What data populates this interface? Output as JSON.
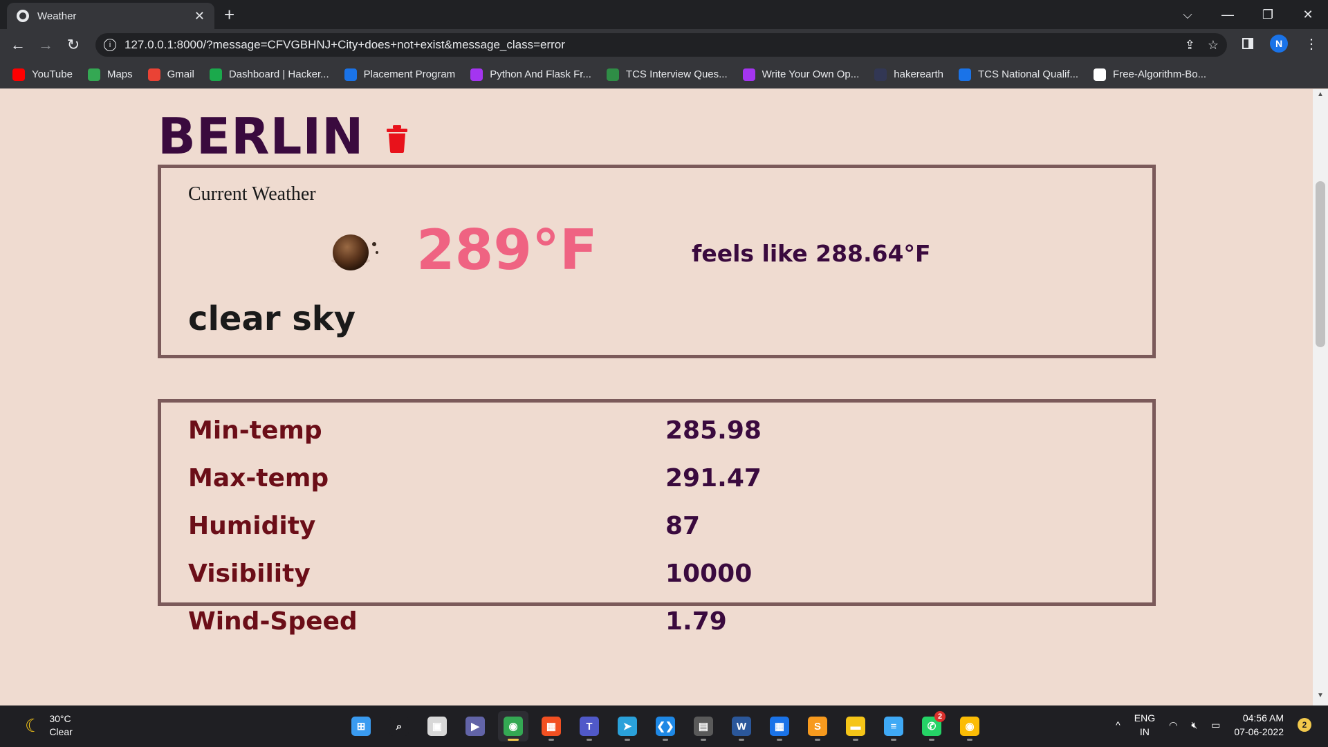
{
  "browser": {
    "tab_title": "Weather",
    "tab_close": "✕",
    "new_tab": "+",
    "url": "127.0.0.1:8000/?message=CFVGBHNJ+City+does+not+exist&message_class=error",
    "profile_initial": "N",
    "window_controls": {
      "dropdown": "⌵",
      "minimize": "—",
      "restore": "❐",
      "close": "✕"
    }
  },
  "bookmarks": [
    {
      "label": "YouTube",
      "icon": "youtube-icon",
      "color": "#ff0000"
    },
    {
      "label": "Maps",
      "icon": "maps-icon",
      "color": "#34a853"
    },
    {
      "label": "Gmail",
      "icon": "gmail-icon",
      "color": "#ea4335"
    },
    {
      "label": "Dashboard | Hacker...",
      "icon": "hackerrank-icon",
      "color": "#1ba94c"
    },
    {
      "label": "Placement Program",
      "icon": "placement-icon",
      "color": "#1a73e8"
    },
    {
      "label": "Python And Flask Fr...",
      "icon": "udemy-icon",
      "color": "#a435f0"
    },
    {
      "label": "TCS Interview Ques...",
      "icon": "gfg-icon",
      "color": "#2f8d46"
    },
    {
      "label": "Write Your Own Op...",
      "icon": "udemy-icon",
      "color": "#a435f0"
    },
    {
      "label": "hakerearth",
      "icon": "hackerearth-icon",
      "color": "#323754"
    },
    {
      "label": "TCS National Qualif...",
      "icon": "tcs-icon",
      "color": "#1a73e8"
    },
    {
      "label": "Free-Algorithm-Bo...",
      "icon": "github-icon",
      "color": "#ffffff"
    }
  ],
  "weather": {
    "city": "BERLIN",
    "current_label": "Current Weather",
    "temperature": "289°F",
    "feels_like": "feels like 288.64°F",
    "condition": "clear sky",
    "stats": [
      {
        "label": "Min-temp",
        "value": "285.98"
      },
      {
        "label": "Max-temp",
        "value": "291.47"
      },
      {
        "label": "Humidity",
        "value": "87"
      },
      {
        "label": "Visibility",
        "value": "10000"
      },
      {
        "label": "Wind-Speed",
        "value": "1.79"
      }
    ]
  },
  "colors": {
    "page_bg": "#efdbd0",
    "city_title": "#3a0a3e",
    "temperature": "#ef6382",
    "card_border": "#7b5a5a",
    "stat_label": "#6b0e18",
    "trash": "#e8121b"
  },
  "taskbar": {
    "weather_temp": "30°C",
    "weather_desc": "Clear",
    "lang_top": "ENG",
    "lang_bottom": "IN",
    "time": "04:56 AM",
    "date": "07-06-2022",
    "notification_count": "2",
    "whatsapp_badge": "2",
    "apps": [
      {
        "name": "start-button",
        "glyph": "⊞",
        "color": "#3a9bf0"
      },
      {
        "name": "search-button",
        "glyph": "⌕",
        "color": "#1f1f23"
      },
      {
        "name": "task-view-button",
        "glyph": "▣",
        "color": "#d8d8d8"
      },
      {
        "name": "chat-app",
        "glyph": "▶",
        "color": "#6264a7"
      },
      {
        "name": "chrome-app",
        "glyph": "◉",
        "color": "#34a853"
      },
      {
        "name": "store-app",
        "glyph": "▦",
        "color": "#f25022"
      },
      {
        "name": "teams-app",
        "glyph": "T",
        "color": "#5059c9"
      },
      {
        "name": "telegram-app",
        "glyph": "➤",
        "color": "#2aa1da"
      },
      {
        "name": "vscode-app",
        "glyph": "❮❯",
        "color": "#1e88e5"
      },
      {
        "name": "calculator-app",
        "glyph": "▤",
        "color": "#5a5a5a"
      },
      {
        "name": "word-app",
        "glyph": "W",
        "color": "#2b579a"
      },
      {
        "name": "calendar-app",
        "glyph": "▦",
        "color": "#1a73e8"
      },
      {
        "name": "sublime-app",
        "glyph": "S",
        "color": "#f79a1e"
      },
      {
        "name": "file-explorer-app",
        "glyph": "▬",
        "color": "#f5c518"
      },
      {
        "name": "notepad-app",
        "glyph": "≡",
        "color": "#3fa9f5"
      },
      {
        "name": "whatsapp-app",
        "glyph": "✆",
        "color": "#25d366"
      },
      {
        "name": "chrome-profile-app",
        "glyph": "◉",
        "color": "#fbbc05"
      }
    ]
  }
}
